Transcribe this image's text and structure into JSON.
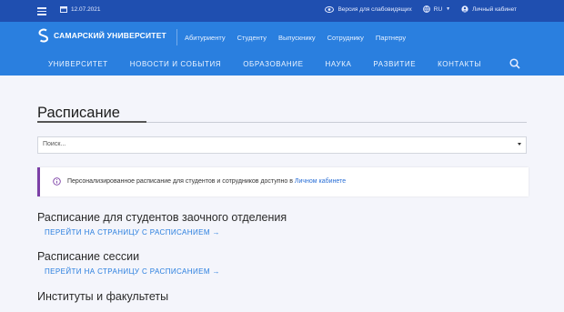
{
  "topbar": {
    "date": "12.07.2021",
    "accessibility": "Версия для слабовидящих",
    "language": "RU",
    "account": "Личный кабинет"
  },
  "header": {
    "logo": "САМАРСКИЙ УНИВЕРСИТЕТ",
    "audience_links": [
      "Абитуриенту",
      "Студенту",
      "Выпускнику",
      "Сотруднику",
      "Партнеру"
    ],
    "main_nav": [
      "УНИВЕРСИТЕТ",
      "НОВОСТИ И СОБЫТИЯ",
      "ОБРАЗОВАНИЕ",
      "НАУКА",
      "РАЗВИТИЕ",
      "КОНТАКТЫ"
    ]
  },
  "page": {
    "title": "Расписание",
    "search_placeholder": "Поиск...",
    "alert_text": "Персонализированное расписание для студентов и сотрудников доступно в ",
    "alert_link": "Личном кабинете",
    "sections": [
      {
        "heading": "Расписание для студентов заочного отделения",
        "link": "ПЕРЕЙТИ НА СТРАНИЦУ С РАСПИСАНИЕМ →"
      },
      {
        "heading": "Расписание сессии",
        "link": "ПЕРЕЙТИ НА СТРАНИЦУ С РАСПИСАНИЕМ →"
      },
      {
        "heading": "Институты и факультеты",
        "link": ""
      }
    ]
  },
  "colors": {
    "topbar": "#1f4fb0",
    "header": "#2a7fdf",
    "accent": "#7b3fa6",
    "link": "#2a7fdf"
  }
}
